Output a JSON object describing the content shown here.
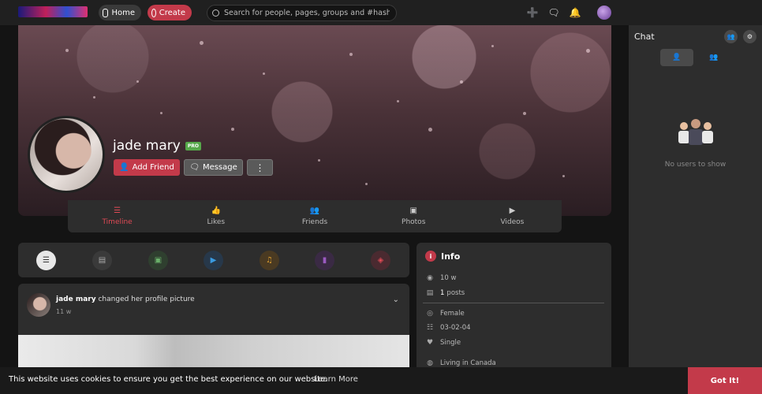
{
  "topbar": {
    "home_label": "Home",
    "create_label": "Create",
    "search_placeholder": "Search for people, pages, groups and #hashtags"
  },
  "profile": {
    "name": "jade mary",
    "badge": "PRO",
    "add_friend_label": "Add Friend",
    "message_label": "Message",
    "more_label": "⋮"
  },
  "tabs": [
    {
      "label": "Timeline",
      "active": true
    },
    {
      "label": "Likes"
    },
    {
      "label": "Friends"
    },
    {
      "label": "Photos"
    },
    {
      "label": "Videos"
    }
  ],
  "post": {
    "author": "jade mary",
    "action": "changed her profile picture",
    "time": "11 w"
  },
  "info": {
    "title": "Info",
    "views": "10 w",
    "posts_count": "1",
    "posts_label": "posts",
    "gender": "Female",
    "birthday": "03-02-04",
    "relationship": "Single",
    "location": "Living in Canada"
  },
  "chat": {
    "title": "Chat",
    "empty_text": "No users to show"
  },
  "cookie": {
    "text": "This website uses cookies to ensure you get the best experience on our website.",
    "link": "Learn More",
    "button": "Got It!"
  },
  "colors": {
    "accent": "#c33a4a",
    "active_tab": "#e04a55",
    "pro_badge": "#56a84a"
  }
}
